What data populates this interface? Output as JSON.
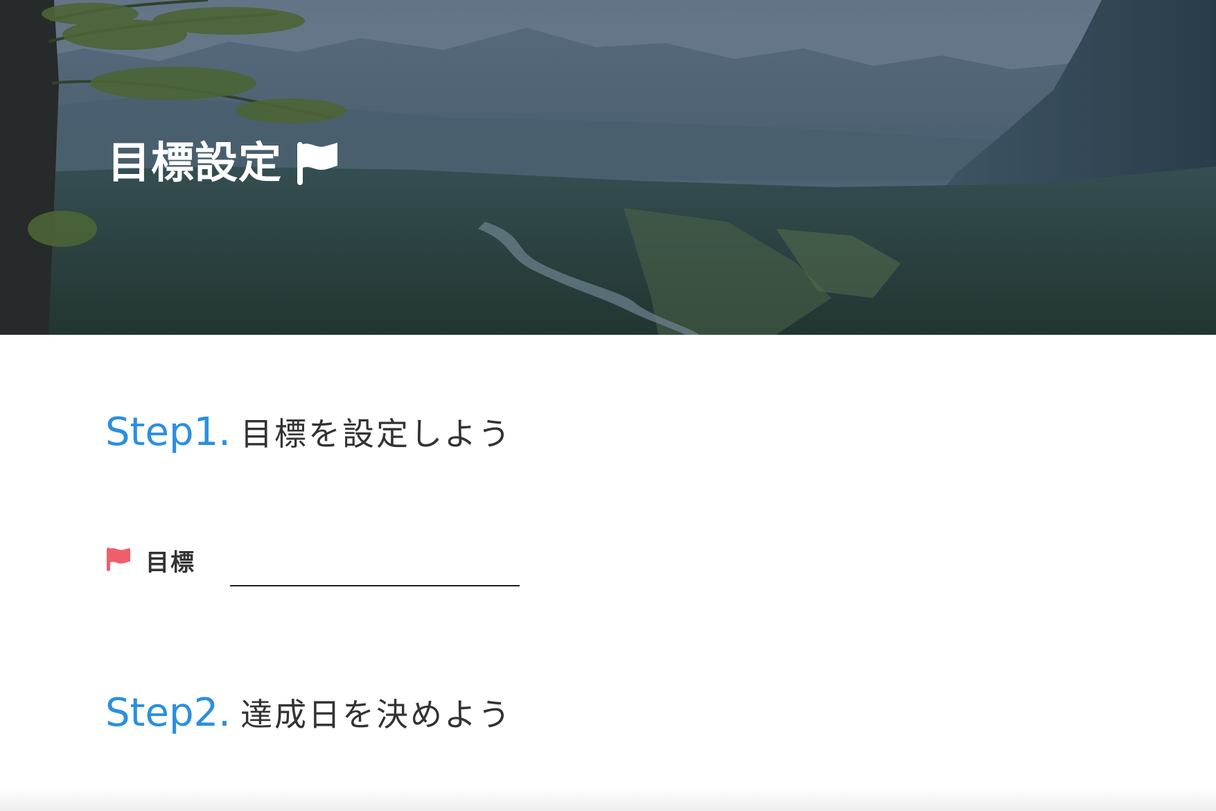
{
  "hero": {
    "title": "目標設定",
    "title_icon": "flag-icon",
    "background": "mountain-valley-photo"
  },
  "steps": [
    {
      "number": "Step1.",
      "text": "目標を設定しよう"
    },
    {
      "number": "Step2.",
      "text": "達成日を決めよう"
    }
  ],
  "goal": {
    "icon": "flag-icon",
    "label": "目標",
    "value": ""
  },
  "colors": {
    "accent_blue": "#2b8fe0",
    "flag_red": "#ef5f6b",
    "text_dark": "#333333"
  }
}
